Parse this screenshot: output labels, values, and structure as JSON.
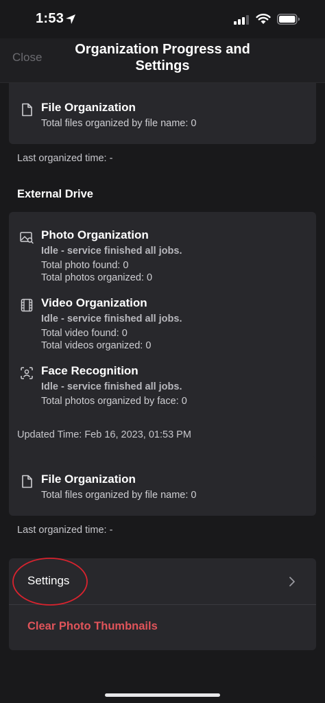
{
  "status_bar": {
    "time": "1:53"
  },
  "nav": {
    "close_label": "Close",
    "title_line1": "Organization Progress and",
    "title_line2": "Settings"
  },
  "top_section": {
    "file_org": {
      "title": "File Organization",
      "line1": "Total files organized by file name: 0"
    },
    "last_organized": "Last organized time: -"
  },
  "external_drive": {
    "section_title": "External Drive",
    "photo": {
      "title": "Photo Organization",
      "status": "Idle - service finished all jobs.",
      "line1": "Total photo found: 0",
      "line2": "Total photos organized: 0"
    },
    "video": {
      "title": "Video Organization",
      "status": "Idle - service finished all jobs.",
      "line1": "Total video found: 0",
      "line2": "Total videos organized: 0"
    },
    "face": {
      "title": "Face Recognition",
      "status": "Idle - service finished all jobs.",
      "line1": "Total photos organized by face: 0"
    },
    "updated_time": "Updated Time: Feb 16, 2023, 01:53 PM",
    "file_org": {
      "title": "File Organization",
      "line1": "Total files organized by file name: 0"
    },
    "last_organized": "Last organized time: -"
  },
  "settings_list": {
    "settings_label": "Settings",
    "clear_label": "Clear Photo Thumbnails"
  },
  "colors": {
    "background": "#19191b",
    "card": "#28282c",
    "danger": "#e0545a",
    "annotation": "#d9232e"
  },
  "icons": [
    "location-arrow-icon",
    "signal-icon",
    "wifi-icon",
    "battery-icon",
    "file-icon",
    "photo-search-icon",
    "film-icon",
    "face-scan-icon",
    "chevron-right-icon"
  ]
}
